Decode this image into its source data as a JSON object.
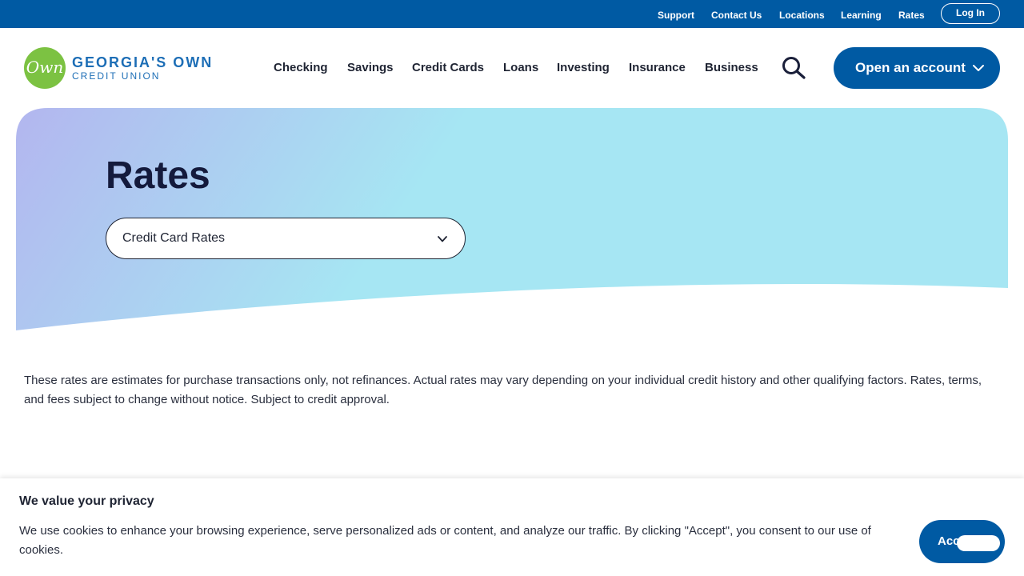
{
  "utility_nav": {
    "links": [
      "Support",
      "Contact Us",
      "Locations",
      "Learning",
      "Rates"
    ],
    "login_label": "Log In"
  },
  "logo": {
    "mark_text": "Own",
    "line1": "GEORGIA'S OWN",
    "line2": "CREDIT UNION"
  },
  "main_nav": {
    "items": [
      "Checking",
      "Savings",
      "Credit Cards",
      "Loans",
      "Investing",
      "Insurance",
      "Business"
    ],
    "search_icon": "search-icon",
    "open_account_label": "Open an account"
  },
  "hero": {
    "title": "Rates",
    "select_value": "Credit Card Rates"
  },
  "content": {
    "disclaimer": "These rates are estimates for purchase transactions only, not refinances. Actual rates may vary depending on your individual credit history and other qualifying factors. Rates, terms, and fees subject to change without notice. Subject to credit approval."
  },
  "cookie_banner": {
    "title": "We value your privacy",
    "text": "We use cookies to enhance your browsing experience, serve personalized ads or content, and analyze our traffic. By clicking \"Accept\", you consent to our use of cookies.",
    "accept_label": "Accept"
  },
  "colors": {
    "brand_blue": "#005aa3",
    "logo_green": "#7cc242",
    "hero_gradient_start": "#b3b6ef",
    "hero_gradient_end": "#a6e6f3",
    "title_navy": "#141a3c"
  }
}
